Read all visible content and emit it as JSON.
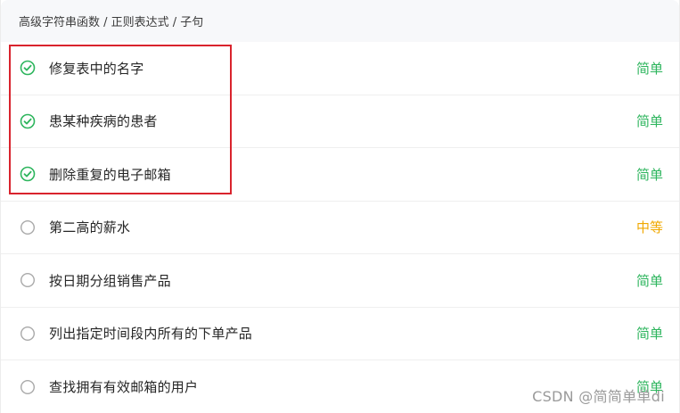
{
  "breadcrumb": "高级字符串函数 / 正则表达式 / 子句",
  "problems": [
    {
      "title": "修复表中的名字",
      "difficulty": "简单",
      "level": "easy",
      "status": "solved"
    },
    {
      "title": "患某种疾病的患者",
      "difficulty": "简单",
      "level": "easy",
      "status": "solved"
    },
    {
      "title": "删除重复的电子邮箱",
      "difficulty": "简单",
      "level": "easy",
      "status": "solved"
    },
    {
      "title": "第二高的薪水",
      "difficulty": "中等",
      "level": "medium",
      "status": "unsolved"
    },
    {
      "title": "按日期分组销售产品",
      "difficulty": "简单",
      "level": "easy",
      "status": "unsolved"
    },
    {
      "title": "列出指定时间段内所有的下单产品",
      "difficulty": "简单",
      "level": "easy",
      "status": "unsolved"
    },
    {
      "title": "查找拥有有效邮箱的用户",
      "difficulty": "简单",
      "level": "easy",
      "status": "unsolved"
    }
  ],
  "colors": {
    "easy": "#2db55d",
    "medium": "#f0a800",
    "highlight": "#d9232d"
  },
  "watermark": "CSDN @简简单单di"
}
